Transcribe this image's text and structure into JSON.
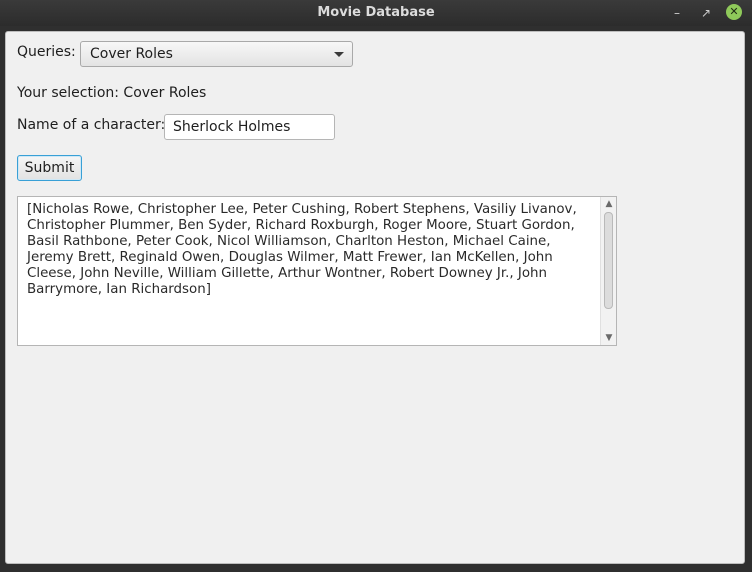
{
  "window": {
    "title": "Movie Database",
    "controls": {
      "minimize_icon": "minimize-icon",
      "maximize_icon": "maximize-icon",
      "close_icon": "close-icon"
    }
  },
  "form": {
    "queries_label": "Queries:",
    "queries_selected": "Cover Roles",
    "selection_prefix": "Your selection: Cover Roles",
    "character_label": "Name of a character:",
    "character_value": "Sherlock Holmes",
    "submit_label": "Submit"
  },
  "results": {
    "text": "[Nicholas Rowe, Christopher Lee, Peter Cushing, Robert Stephens, Vasiliy Livanov, Christopher Plummer, Ben Syder, Richard Roxburgh, Roger Moore, Stuart Gordon, Basil Rathbone, Peter Cook, Nicol Williamson, Charlton Heston, Michael Caine, Jeremy Brett, Reginald Owen, Douglas Wilmer, Matt Frewer, Ian McKellen, John Cleese, John Neville, William Gillette, Arthur Wontner, Robert Downey Jr., John Barrymore, Ian Richardson]"
  },
  "colors": {
    "titlebar": "#2c2c2c",
    "close_button": "#8fc95a",
    "focus_border": "#39a0d6"
  }
}
